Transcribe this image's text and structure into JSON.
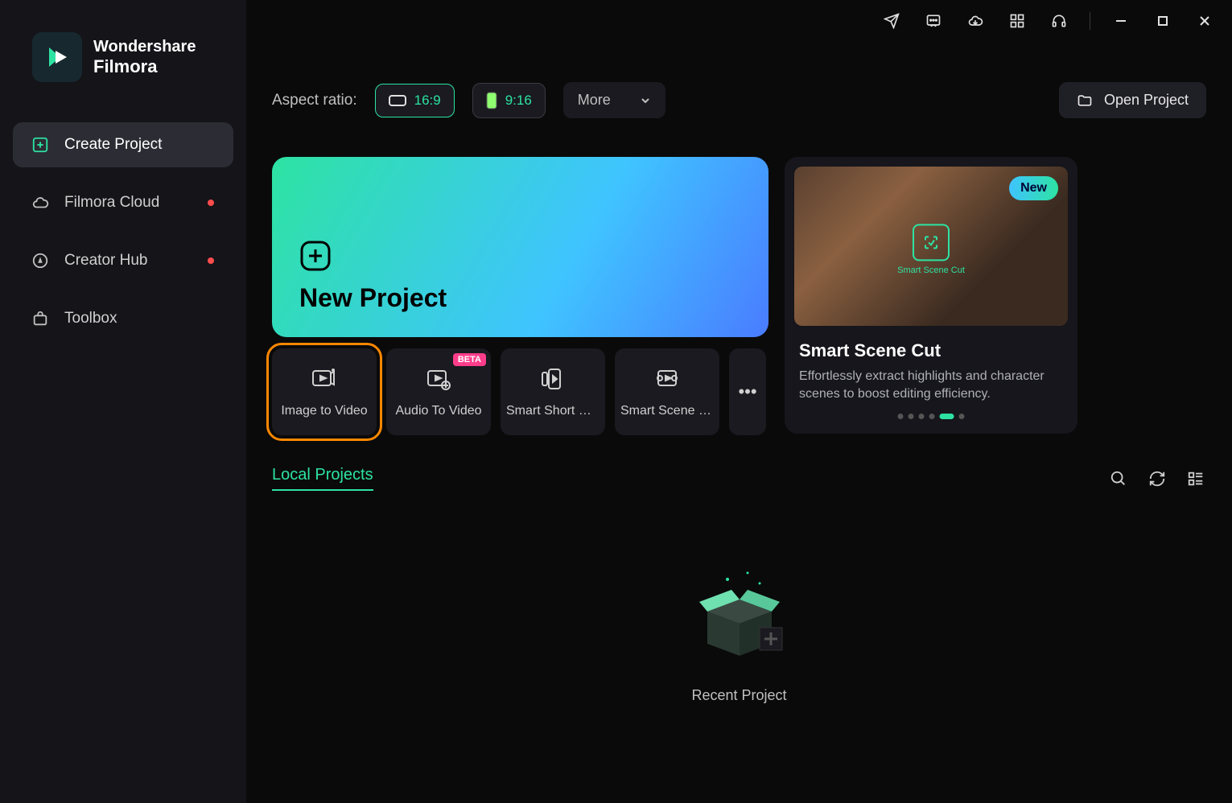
{
  "brand": {
    "line1": "Wondershare",
    "line2": "Filmora"
  },
  "sidebar": {
    "items": [
      {
        "label": "Create Project",
        "icon": "plus-square-icon",
        "active": true,
        "dot": false
      },
      {
        "label": "Filmora Cloud",
        "icon": "cloud-icon",
        "active": false,
        "dot": true
      },
      {
        "label": "Creator Hub",
        "icon": "compass-icon",
        "active": false,
        "dot": true
      },
      {
        "label": "Toolbox",
        "icon": "tools-icon",
        "active": false,
        "dot": false
      }
    ]
  },
  "titlebar": {
    "icons": [
      "send-icon",
      "feedback-icon",
      "download-cloud-icon",
      "grid-apps-icon",
      "headset-icon"
    ],
    "window": [
      "minimize-icon",
      "maximize-icon",
      "close-icon"
    ]
  },
  "aspect_ratio": {
    "label": "Aspect ratio:",
    "options": [
      {
        "value": "16:9",
        "selected": true
      },
      {
        "value": "9:16",
        "selected": false
      }
    ],
    "more_label": "More"
  },
  "open_project_label": "Open Project",
  "hero": {
    "new_project_label": "New Project"
  },
  "tools": [
    {
      "label": "Image to Video",
      "badge": null,
      "highlighted": true
    },
    {
      "label": "Audio To Video",
      "badge": "BETA",
      "highlighted": false
    },
    {
      "label": "Smart Short Cli...",
      "badge": null,
      "highlighted": false
    },
    {
      "label": "Smart Scene Cut",
      "badge": null,
      "highlighted": false
    }
  ],
  "feature": {
    "badge": "New",
    "thumb_label": "Smart Scene Cut",
    "title": "Smart Scene Cut",
    "description": "Effortlessly extract highlights and character scenes to boost editing efficiency.",
    "dots_total": 6,
    "dots_active_index": 4
  },
  "local": {
    "tab_label": "Local Projects",
    "empty_label": "Recent Project"
  },
  "colors": {
    "accent": "#2de3a2",
    "highlight_border": "#ff8800",
    "beta": "#ff3d8b"
  }
}
